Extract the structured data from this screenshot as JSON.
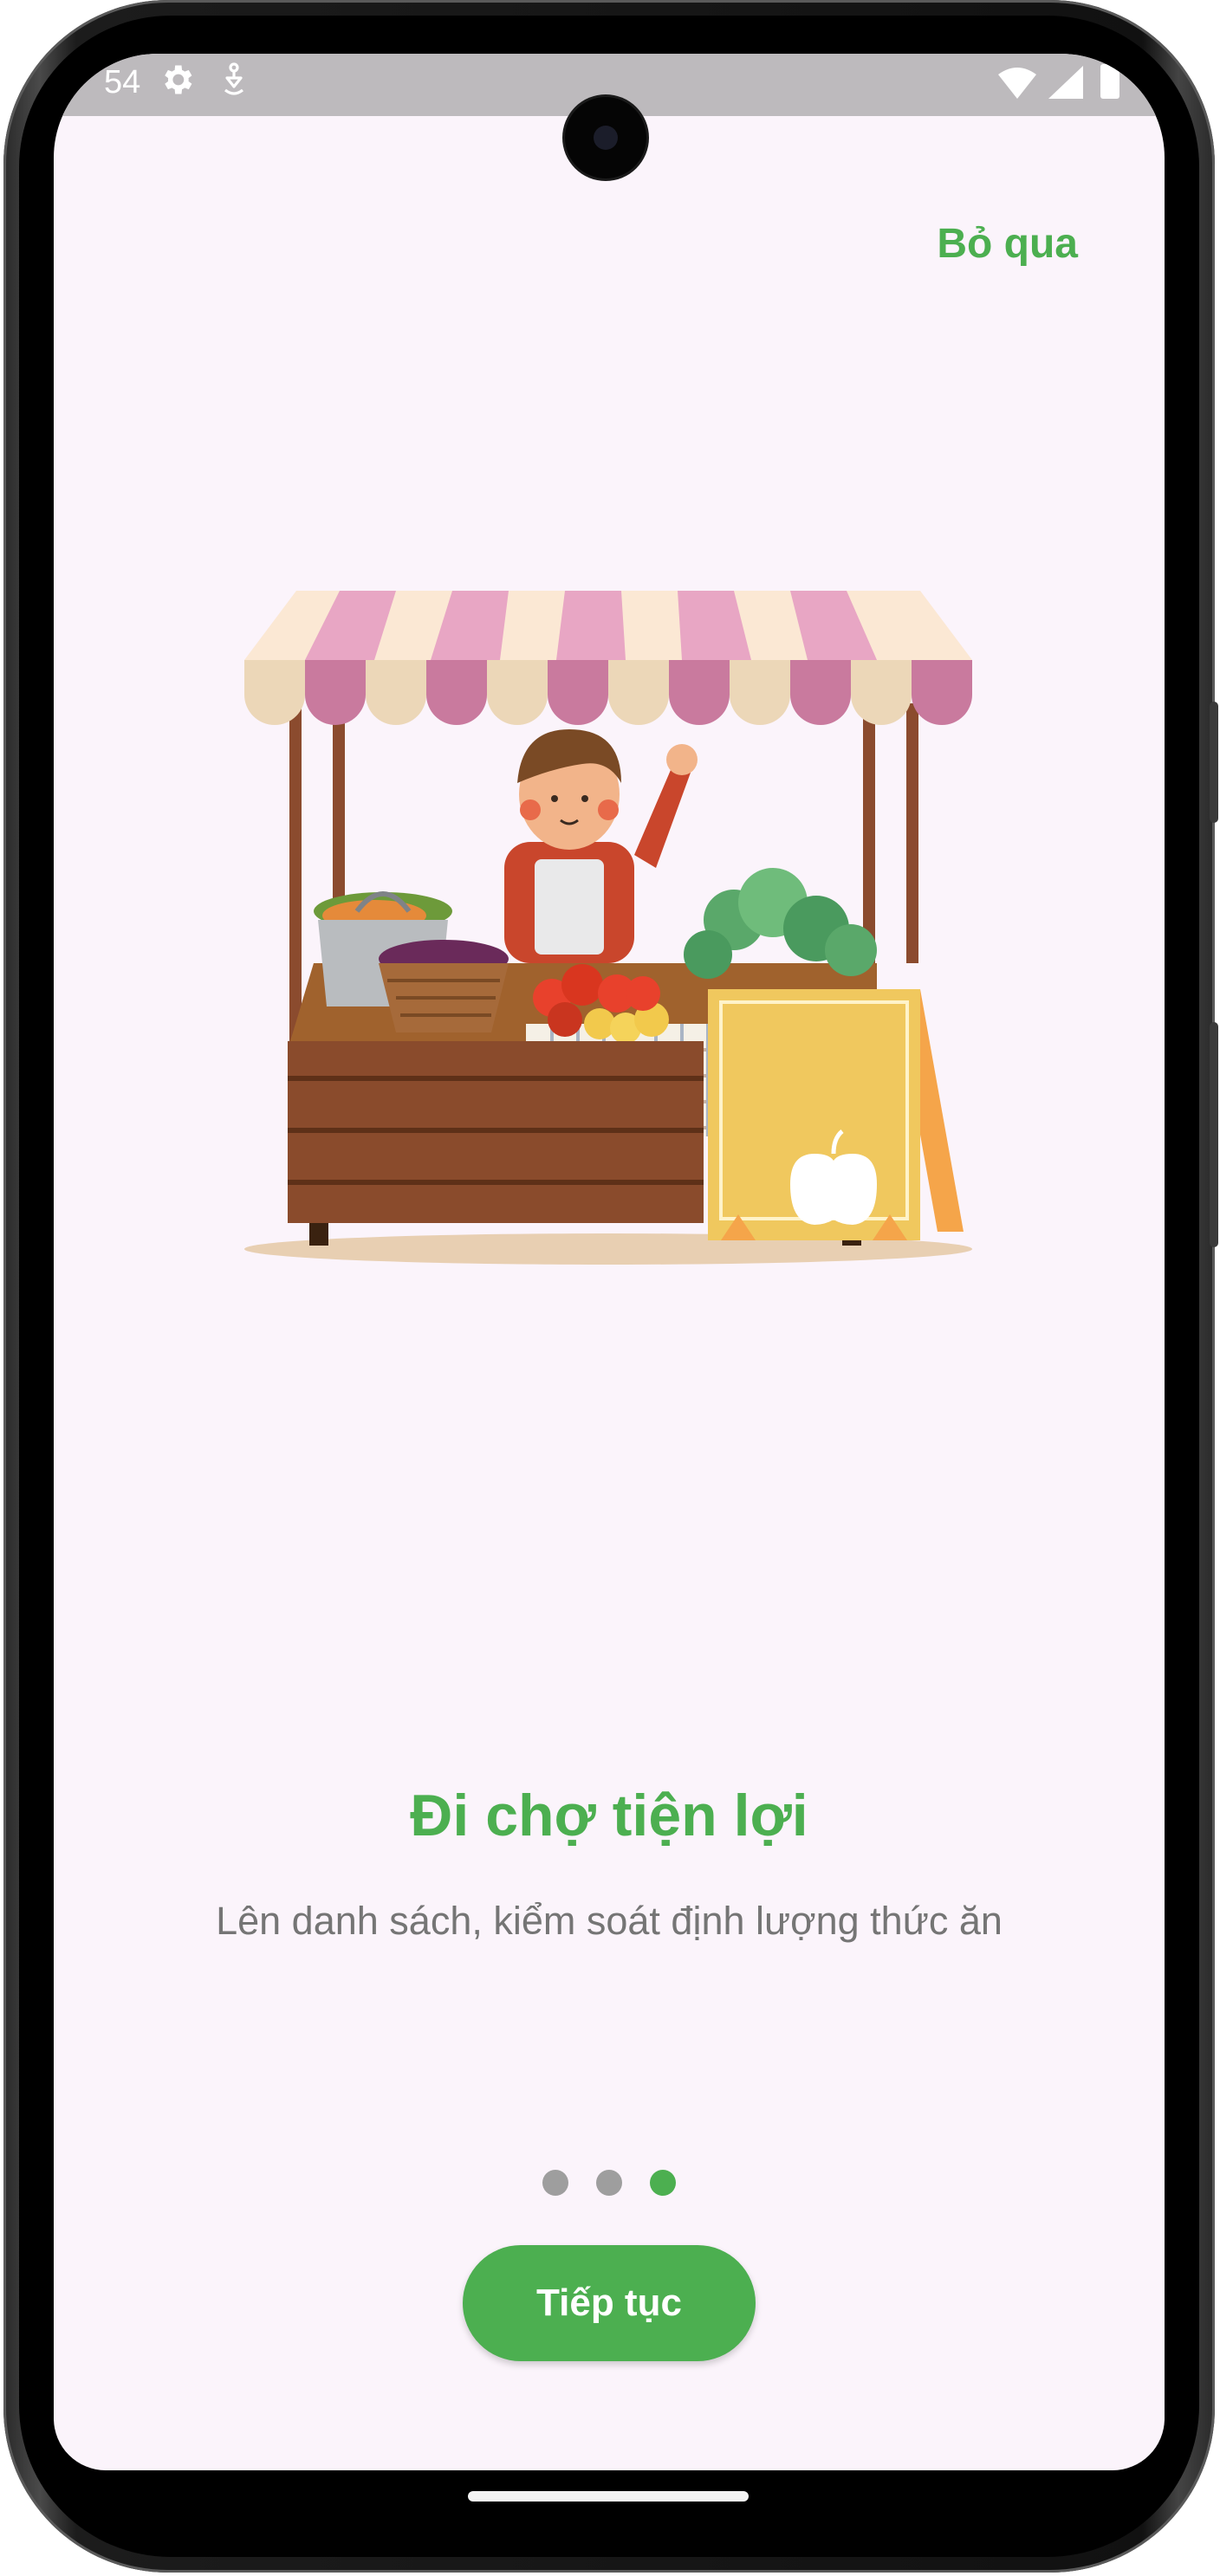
{
  "status_bar": {
    "time": "54",
    "icons": [
      "gear-icon",
      "app-notification-icon",
      "wifi-icon",
      "cellular-signal-icon",
      "battery-icon"
    ]
  },
  "onboarding": {
    "skip_label": "Bỏ qua",
    "title": "Đi chợ tiện lợi",
    "description": "Lên danh sách, kiểm soát định lượng thức ăn",
    "page_count": 3,
    "current_page": 3,
    "continue_label": "Tiếp tục",
    "illustration": "market-stall-illustration"
  },
  "colors": {
    "accent": "#4caf50",
    "screen_background": "#fbf4fb",
    "status_bar": "#bdbabd",
    "dot_inactive": "#9e9e9e",
    "subtitle_text": "#757575"
  }
}
